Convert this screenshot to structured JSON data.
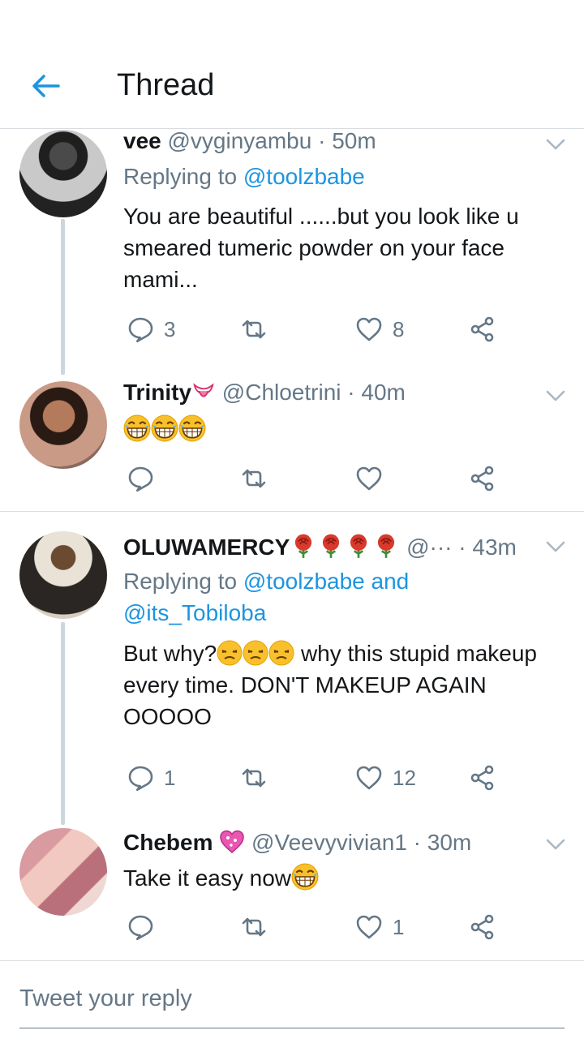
{
  "header": {
    "title": "Thread"
  },
  "tweets": [
    {
      "name": "vee",
      "handle": "@vyginyambu",
      "time": "50m",
      "reply_prefix": "Replying to ",
      "reply_mentions": "@toolzbabe",
      "text": "You are beautiful ......but you look like u smeared tumeric powder on your face mami...",
      "replies": "3",
      "retweets": "",
      "likes": "8"
    },
    {
      "name": "Trinity",
      "handle": "@Chloetrini",
      "time": "40m",
      "text": "",
      "replies": "",
      "retweets": "",
      "likes": ""
    },
    {
      "name": "OLUWAMERCY",
      "handle": "@···",
      "time": "43m",
      "reply_prefix": "Replying to ",
      "reply_mentions_1": "@toolzbabe",
      "reply_and": " and",
      "reply_mentions_2": "@its_Tobiloba",
      "text_a": "But why?",
      "text_b": " why this stupid makeup every time. DON'T MAKEUP AGAIN OOOOO",
      "replies": "1",
      "retweets": "",
      "likes": "12"
    },
    {
      "name": "Chebem",
      "handle": "@Veevyvivian1",
      "time": "30m",
      "text": "Take it easy now",
      "replies": "",
      "retweets": "",
      "likes": "1"
    }
  ],
  "composer": {
    "placeholder": "Tweet your reply"
  },
  "colors": {
    "accent": "#1b95e0",
    "secondary_text": "#657786",
    "thread_line": "#ccd6dd"
  },
  "icons": [
    "back-arrow-icon",
    "chevron-down-icon",
    "reply-icon",
    "retweet-icon",
    "like-icon",
    "share-icon"
  ]
}
